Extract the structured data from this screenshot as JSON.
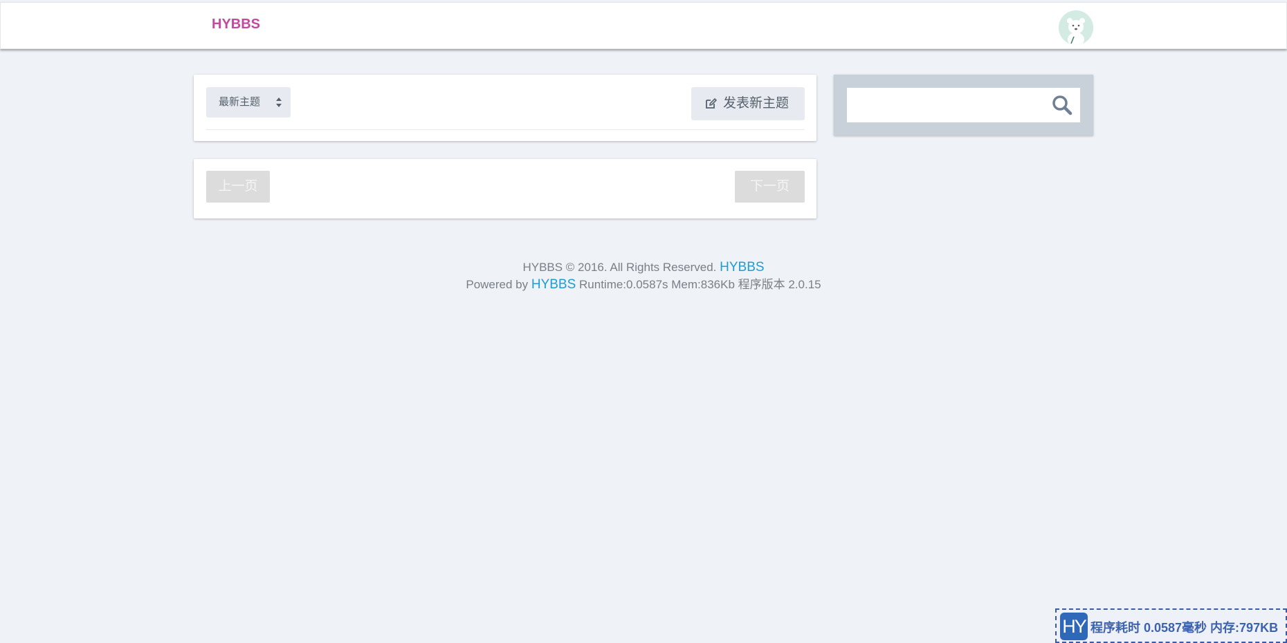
{
  "header": {
    "logo_text": "HYBBS",
    "avatar_alt": "user avatar"
  },
  "topics": {
    "sort_label": "最新主题",
    "new_topic_label": "发表新主题"
  },
  "pager": {
    "prev_label": "上一页",
    "next_label": "下一页"
  },
  "search": {
    "placeholder": "",
    "value": ""
  },
  "footer": {
    "copyright_text": "HYBBS © 2016. All Rights Reserved. ",
    "copyright_link": "HYBBS",
    "powered_prefix": "Powered by ",
    "powered_link": "HYBBS",
    "runtime_text": " Runtime:0.0587s Mem:836Kb 程序版本 2.0.15"
  },
  "debug_badge": {
    "logo_text": "HY",
    "text": "程序耗时 0.0587毫秒 内存:797KB"
  },
  "colors": {
    "brand": "#c3489f",
    "link": "#1d9cd4",
    "page_bg": "#eff2f7",
    "debug": "#3d62ad"
  },
  "icons": {
    "sort": "sort-updown-icon",
    "new_topic": "edit-icon",
    "search": "search-icon"
  }
}
